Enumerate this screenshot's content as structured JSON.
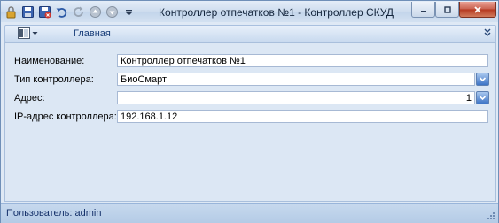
{
  "window": {
    "title": "Контроллер отпечатков №1 - Контроллер СКУД"
  },
  "quick_access": [
    "lock-icon",
    "save-icon",
    "save-close-icon",
    "undo-icon",
    "refresh-icon",
    "prev-icon",
    "next-icon",
    "customize-icon"
  ],
  "ribbon": {
    "tab_home": "Главная"
  },
  "form": {
    "name_label": "Наименование:",
    "name_value": "Контроллер отпечатков №1",
    "type_label": "Тип контроллера:",
    "type_value": "БиоСмарт",
    "address_label": "Адрес:",
    "address_value": "1",
    "ip_label": "IP-адрес контроллера:",
    "ip_value": "192.168.1.12"
  },
  "status": {
    "user_text": "Пользователь: admin"
  },
  "colors": {
    "accent": "#3d74c6",
    "close": "#c85f4d",
    "panel_bg": "#dce7f4"
  }
}
